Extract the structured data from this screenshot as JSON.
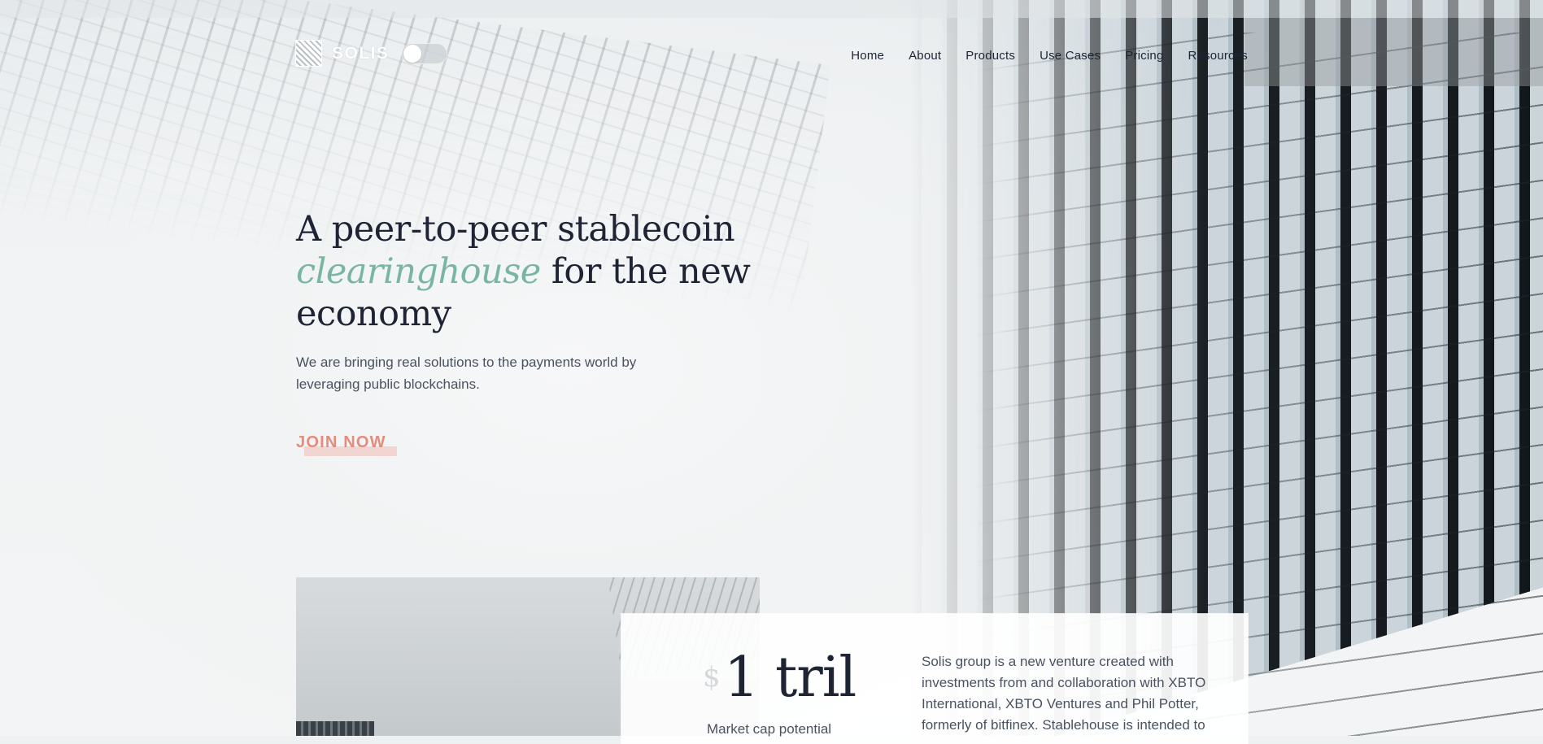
{
  "brand": {
    "name": "SOLIS",
    "logo_icon": "woven-square-icon"
  },
  "theme_toggle": {
    "state": "off"
  },
  "nav": {
    "items": [
      "Home",
      "About",
      "Products",
      "Use Cases",
      "Pricing",
      "Resources"
    ]
  },
  "hero": {
    "title_line1": "A peer-to-peer stablecoin",
    "title_accent": "clearinghouse",
    "title_line2_rest": " for the new",
    "title_line3": "economy",
    "subtitle": "We are bringing real solutions to the payments world by leveraging public blockchains.",
    "cta_label": "JOIN NOW"
  },
  "stats": {
    "currency": "$",
    "value": "1 tril",
    "label": "Market cap potential"
  },
  "about": {
    "text": "Solis group is a new venture created with investments from and collaboration with XBTO International, XBTO Ventures and Phil Potter, formerly of bitfinex. Stablehouse is intended to"
  },
  "colors": {
    "text_dark": "#1e2433",
    "accent_green": "#78b5a2",
    "accent_coral": "#e88b7a",
    "muted_text": "#4a5260"
  }
}
